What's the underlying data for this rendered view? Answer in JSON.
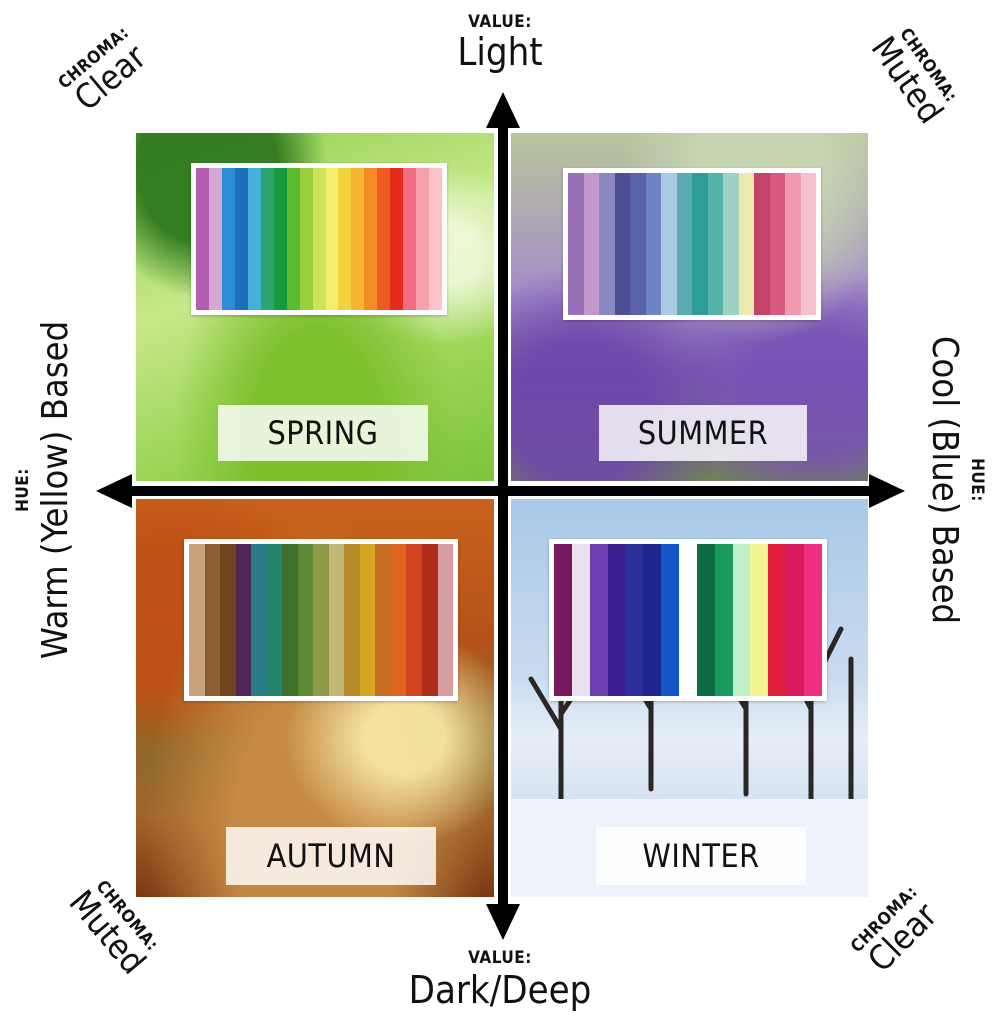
{
  "axes": {
    "top": {
      "label": "VALUE:",
      "value": "Light"
    },
    "bottom": {
      "label": "VALUE:",
      "value": "Dark/Deep"
    },
    "left": {
      "label": "HUE:",
      "value": "Warm (Yellow) Based"
    },
    "right": {
      "label": "HUE:",
      "value": "Cool (Blue) Based"
    }
  },
  "corners": {
    "top_left": {
      "label": "CHROMA:",
      "value": "Clear"
    },
    "top_right": {
      "label": "CHROMA:",
      "value": "Muted"
    },
    "bottom_left": {
      "label": "CHROMA:",
      "value": "Muted"
    },
    "bottom_right": {
      "label": "CHROMA:",
      "value": "Clear"
    }
  },
  "quadrants": {
    "spring": {
      "name": "SPRING",
      "palette": [
        "#b25fb0",
        "#d6a9d5",
        "#2c8fd6",
        "#1e6fb8",
        "#43b1d8",
        "#2da46f",
        "#159b3c",
        "#5cba2f",
        "#9ccf3d",
        "#cfe35a",
        "#f3ee6c",
        "#f4d23b",
        "#f7b531",
        "#f48b24",
        "#ef5a23",
        "#e52c1c",
        "#f06d82",
        "#f5a0ab",
        "#f9c3c8"
      ]
    },
    "summer": {
      "name": "SUMMER",
      "palette": [
        "#9a70b8",
        "#c498c9",
        "#8a88c4",
        "#4d4f93",
        "#5a62a8",
        "#6f84c4",
        "#a8cbe4",
        "#5aa9b3",
        "#2f9d97",
        "#55b4a9",
        "#9fd1c2",
        "#e9eab0",
        "#c5426a",
        "#d95a7e",
        "#f09ab0",
        "#f6c0cd"
      ]
    },
    "autumn": {
      "name": "AUTUMN",
      "palette": [
        "#c8a27a",
        "#8d5c32",
        "#6f4520",
        "#50265a",
        "#2a7d86",
        "#23856e",
        "#3f6f2b",
        "#5e8a35",
        "#8f9a48",
        "#c2b878",
        "#b78a2a",
        "#d6a521",
        "#c96c23",
        "#e0651f",
        "#d1441e",
        "#b02d1c",
        "#d79da1"
      ]
    },
    "winter": {
      "name": "WINTER",
      "palette": [
        "#7a1a5e",
        "#e9e2f1",
        "#6b3fb0",
        "#3a1d8e",
        "#2b2f9b",
        "#1d2590",
        "#1356c8",
        "#ffffff",
        "#0d6b45",
        "#1a9a5e",
        "#bff0c8",
        "#f3f590",
        "#e01f3c",
        "#d8195e",
        "#ef2f7f"
      ]
    }
  }
}
